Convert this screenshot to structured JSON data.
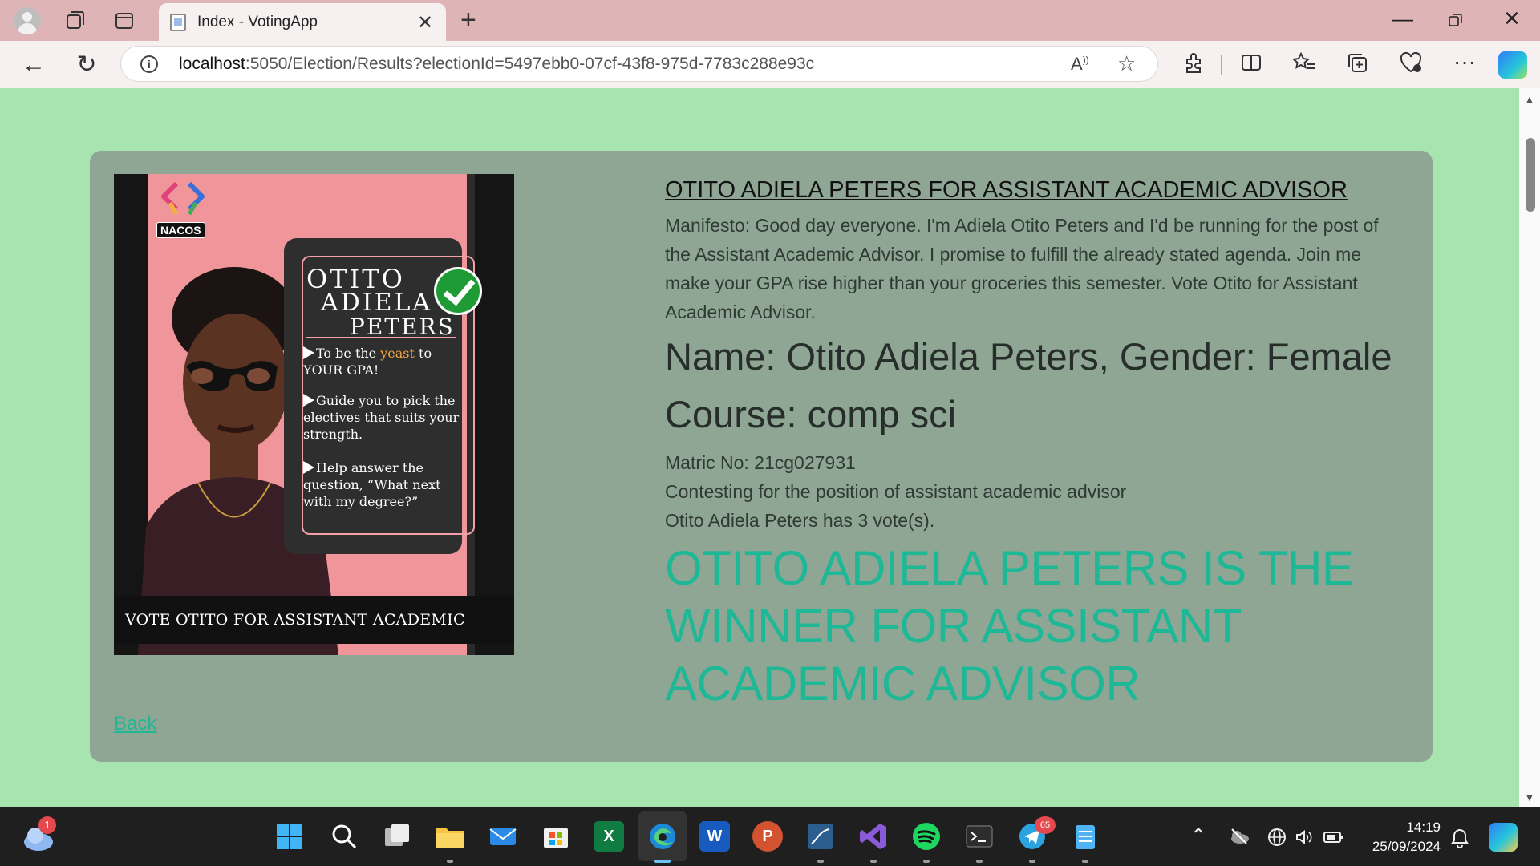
{
  "browser": {
    "tab_title": "Index - VotingApp",
    "url_host": "localhost",
    "url_rest": ":5050/Election/Results?electionId=5497ebb0-07cf-43f8-975d-7783c288e93c",
    "read_aloud": "A̩",
    "icons": [
      "profile-icon",
      "workspaces-icon",
      "tab-actions-icon",
      "back-icon",
      "refresh-icon",
      "info-icon",
      "read-aloud-icon",
      "favorite-star-icon",
      "extensions-icon",
      "split-screen-icon",
      "favorites-icon",
      "collections-icon",
      "browser-essentials-icon",
      "more-icon",
      "copilot-icon"
    ]
  },
  "poster": {
    "logo_text": "NACOS",
    "name_line1": "OTITO",
    "name_line2": "ADIELA",
    "name_line3": "PETERS",
    "bullet1_a": "To be the ",
    "bullet1_yeast": "yeast",
    "bullet1_b": " to YOUR GPA!",
    "bullet2": "Guide you to pick the electives that suits your strength.",
    "bullet3": "Help answer the question, “What next with my degree?”",
    "footer": "VOTE OTITO FOR ASSISTANT ACADEMIC ADVISOR!"
  },
  "candidate": {
    "title": "OTITO ADIELA PETERS FOR ASSISTANT ACADEMIC ADVISOR",
    "manifesto": "Manifesto: Good day everyone. I'm Adiela Otito Peters and I'd be running for the post of the Assistant Academic Advisor. I promise to fulfill the already stated agenda. Join me make your GPA rise higher than your groceries this semester. Vote Otito for Assistant Academic Advisor.",
    "name_gender": "Name: Otito Adiela Peters, Gender: Female",
    "course": "Course: comp sci",
    "matric": "Matric No: 21cg027931",
    "position": "Contesting for the position of assistant academic advisor",
    "votes": "Otito Adiela Peters has 3 vote(s).",
    "winner": "OTITO ADIELA PETERS IS THE WINNER FOR ASSISTANT ACADEMIC ADVISOR"
  },
  "back_link": "Back",
  "taskbar": {
    "weather_badge": "1",
    "telegram_badge": "65",
    "time": "14:19",
    "date": "25/09/2024",
    "apps": [
      "start-icon",
      "search-icon",
      "task-view-icon",
      "file-explorer-icon",
      "mail-icon",
      "store-icon",
      "excel-icon",
      "edge-icon",
      "word-icon",
      "powerpoint-icon",
      "sql-icon",
      "visual-studio-icon",
      "spotify-icon",
      "terminal-icon",
      "telegram-icon",
      "notepad-icon"
    ]
  },
  "colors": {
    "page_bg": "#a8e4b0",
    "card_bg": "#8fa694",
    "winner": "#1fb897",
    "tab_strip": "#dfb4b7"
  }
}
